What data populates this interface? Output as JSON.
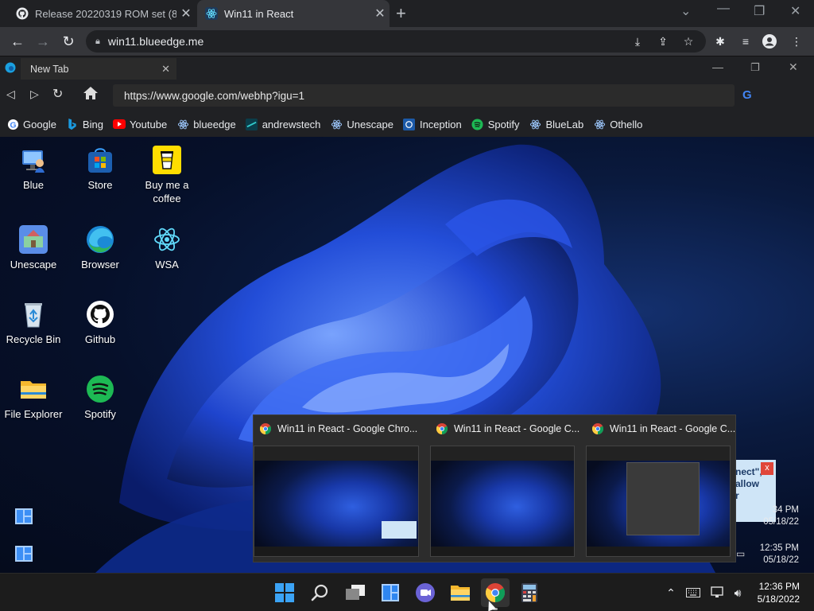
{
  "outer_browser": {
    "tabs": [
      {
        "title": "Release 20220319 ROM set (868",
        "icon": "github-icon"
      },
      {
        "title": "Win11 in React",
        "icon": "react-icon",
        "active": true
      }
    ],
    "address": "win11.blueedge.me"
  },
  "inner_browser": {
    "tab_title": "New Tab",
    "url": "https://www.google.com/webhp?igu=1",
    "bookmarks": [
      "Google",
      "Bing",
      "Youtube",
      "blueedge",
      "andrewstech",
      "Unescape",
      "Inception",
      "Spotify",
      "BlueLab",
      "Othello"
    ]
  },
  "desktop": {
    "icons": [
      {
        "label": "Blue",
        "icon": "user-computer-icon"
      },
      {
        "label": "Store",
        "icon": "store-icon"
      },
      {
        "label": "Buy me a coffee",
        "icon": "coffee-icon"
      },
      {
        "label": "Unescape",
        "icon": "unescape-icon"
      },
      {
        "label": "Browser",
        "icon": "edge-icon"
      },
      {
        "label": "WSA",
        "icon": "react-icon"
      },
      {
        "label": "Recycle Bin",
        "icon": "recycle-bin-icon"
      },
      {
        "label": "Github",
        "icon": "github-icon"
      },
      {
        "label": "File Explorer",
        "icon": "folder-icon"
      },
      {
        "label": "Spotify",
        "icon": "spotify-icon"
      }
    ],
    "notification_text": "nect\",\nallow\nr",
    "ghost_clocks": [
      {
        "time": "34 PM",
        "date": "05/18/22"
      },
      {
        "time": "12:35 PM",
        "date": "05/18/22"
      }
    ]
  },
  "preview": {
    "windows": [
      {
        "title": "Win11 in React - Google Chro..."
      },
      {
        "title": "Win11 in React - Google C..."
      },
      {
        "title": "Win11 in React - Google C..."
      }
    ]
  },
  "taskbar": {
    "time": "12:36 PM",
    "date": "5/18/2022"
  },
  "colors": {
    "desktop_blue": "#1838a8",
    "chrome_dark": "#202124",
    "taskbar": "#1c1c1c"
  }
}
